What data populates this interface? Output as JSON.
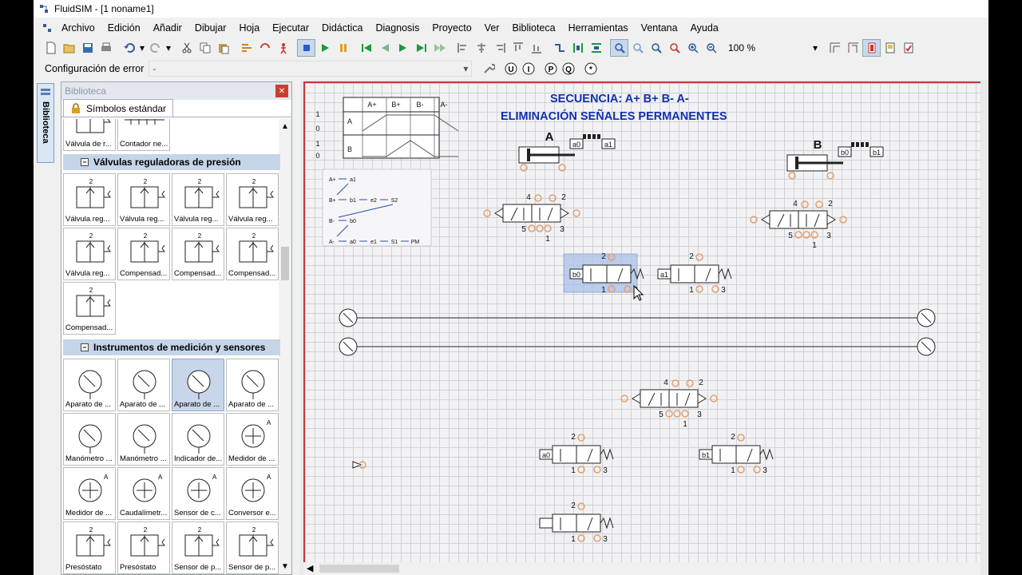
{
  "window": {
    "title": "FluidSIM - [1  noname1]"
  },
  "menu": [
    "Archivo",
    "Edición",
    "Añadir",
    "Dibujar",
    "Hoja",
    "Ejecutar",
    "Didáctica",
    "Diagnosis",
    "Proyecto",
    "Ver",
    "Biblioteca",
    "Herramientas",
    "Ventana",
    "Ayuda"
  ],
  "toolbar": {
    "zoom": "100 %"
  },
  "errbar": {
    "label": "Configuración de error",
    "value": "-"
  },
  "sidetab": {
    "label": "Biblioteca"
  },
  "library": {
    "title": "Biblioteca",
    "tab": "Símbolos estándar",
    "top_items": [
      "Válvula de r...",
      "Contador ne..."
    ],
    "cat1": "Válvulas reguladoras de presión",
    "cat1_items": [
      "Válvula reg...",
      "Válvula reg...",
      "Válvula reg...",
      "Válvula reg...",
      "Válvula reg...",
      "Compensad...",
      "Compensad...",
      "Compensad...",
      "Compensad..."
    ],
    "cat2": "Instrumentos de medición y sensores",
    "cat2_items": [
      "Aparato de ...",
      "Aparato de ...",
      "Aparato de ...",
      "Aparato de ...",
      "Manómetro ...",
      "Manómetro ...",
      "Indicador de...",
      "Medidor de ...",
      "Medidor de ...",
      "Caudalímetr...",
      "Sensor de c...",
      "Conversor e...",
      "Presóstato",
      "Presóstato",
      "Sensor de p...",
      "Sensor de p..."
    ]
  },
  "diagram": {
    "title1": "SECUENCIA: A+ B+ B- A-",
    "title2": "ELIMINACIÓN SEÑALES PERMANENTES",
    "cylA": "A",
    "cylB": "B",
    "phase_header": [
      "A+",
      "B+",
      "B-",
      "A-"
    ],
    "phase_rows": [
      "A",
      "B"
    ],
    "phase_levels": [
      "1",
      "0",
      "1",
      "0"
    ],
    "seq_rows": [
      "A+",
      "B+",
      "B-",
      "A-"
    ],
    "seq_labels": {
      "a1": "a1",
      "b1": "b1",
      "e2": "e2",
      "S2": "S2",
      "b0": "b0",
      "a0": "a0",
      "e1": "e1",
      "S1": "S1",
      "PM": "PM"
    },
    "sensors": {
      "a0": "a0",
      "a1": "a1",
      "b0": "b0",
      "b1": "b1"
    },
    "ports": {
      "p1": "1",
      "p2": "2",
      "p3": "3",
      "p4": "4",
      "p5": "5"
    }
  }
}
